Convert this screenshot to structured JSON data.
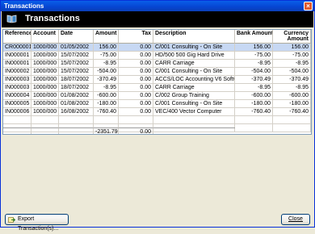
{
  "window": {
    "title": "Transactions"
  },
  "header": {
    "title": "Transactions"
  },
  "table": {
    "columns": [
      "Reference",
      "Account",
      "Date",
      "Amount",
      "Tax",
      "Description",
      "Bank Amount",
      "Currency Amount"
    ],
    "rows": [
      [
        "CR000001",
        "1000/000",
        "01/05/2002",
        "156.00",
        "0.00",
        "C/001 Consulting - On Site",
        "156.00",
        "156.00"
      ],
      [
        "IN000001",
        "1000/000",
        "15/07/2002",
        "-75.00",
        "0.00",
        "HD/500 500 Gig Hard Drive",
        "-75.00",
        "-75.00"
      ],
      [
        "IN000001",
        "1000/000",
        "15/07/2002",
        "-8.95",
        "0.00",
        "CARR Carriage",
        "-8.95",
        "-8.95"
      ],
      [
        "IN000002",
        "1000/000",
        "15/07/2002",
        "-504.00",
        "0.00",
        "C/001 Consulting - On Site",
        "-504.00",
        "-504.00"
      ],
      [
        "IN000003",
        "1000/000",
        "18/07/2002",
        "-370.49",
        "0.00",
        "ACCS/LOC Accounting V6 Software",
        "-370.49",
        "-370.49"
      ],
      [
        "IN000003",
        "1000/000",
        "18/07/2002",
        "-8.95",
        "0.00",
        "CARR Carriage",
        "-8.95",
        "-8.95"
      ],
      [
        "IN000004",
        "1000/000",
        "01/08/2002",
        "-600.00",
        "0.00",
        "C/002 Group Training",
        "-600.00",
        "-600.00"
      ],
      [
        "IN000005",
        "1000/000",
        "01/08/2002",
        "-180.00",
        "0.00",
        "C/001 Consulting - On Site",
        "-180.00",
        "-180.00"
      ],
      [
        "IN000006",
        "1000/000",
        "16/08/2002",
        "-760.40",
        "0.00",
        "VEC/400 Vector Computer",
        "-760.40",
        "-760.40"
      ]
    ],
    "totals": {
      "amount": "-2351.79",
      "tax": "0.00"
    }
  },
  "buttons": {
    "export": "Export Transaction(s)...",
    "close": "Close"
  },
  "icons": {
    "header": "book-icon",
    "export": "export-icon"
  }
}
